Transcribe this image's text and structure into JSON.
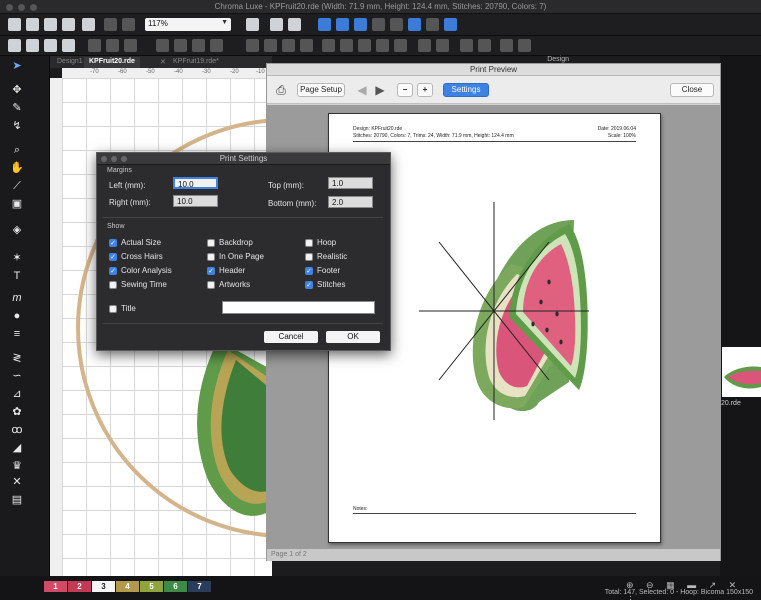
{
  "app": {
    "title": "Chroma Luxe - KPFruit20.rde (Width: 71.9 mm, Height: 124.4 mm, Stitches: 20790, Colors: 7)",
    "design_label": "Design"
  },
  "toolbar": {
    "zoom_value": "117%"
  },
  "doc_tabs": [
    "Design1",
    "KPFruit20.rde",
    "KPFruit19.rde*"
  ],
  "ruler_ticks": [
    "-70",
    "-60",
    "-50",
    "-40",
    "-30",
    "-20",
    "-10"
  ],
  "preview": {
    "window_title": "Print Preview",
    "page_setup_label": "Page Setup",
    "settings_label": "Settings",
    "close_label": "Close",
    "page_indicator": "Page 1 of 2",
    "page": {
      "design_line": "Design: KPFruit20.rde",
      "stats_line": "Stitches: 20790,   Colors: 7,  Trims: 24,   Width: 71.9 mm, Height: 124.4 mm",
      "date_line": "Date: 2019.06.04",
      "scale_line": "Scale: 100%",
      "notes_label": "Notes:"
    }
  },
  "settings": {
    "window_title": "Print Settings",
    "margins_label": "Margins",
    "left_label": "Left (mm):",
    "left_value": "10.0",
    "right_label": "Right (mm):",
    "right_value": "10.0",
    "top_label": "Top (mm):",
    "top_value": "1.0",
    "bottom_label": "Bottom (mm):",
    "bottom_value": "2.0",
    "show_label": "Show",
    "options": {
      "actual_size": {
        "label": "Actual Size",
        "checked": true
      },
      "backdrop": {
        "label": "Backdrop",
        "checked": false
      },
      "hoop": {
        "label": "Hoop",
        "checked": false
      },
      "cross_hairs": {
        "label": "Cross Hairs",
        "checked": true
      },
      "in_one_page": {
        "label": "In One Page",
        "checked": false
      },
      "realistic": {
        "label": "Realistic",
        "checked": false
      },
      "color_analysis": {
        "label": "Color Analysis",
        "checked": true
      },
      "header": {
        "label": "Header",
        "checked": true
      },
      "footer": {
        "label": "Footer",
        "checked": true
      },
      "sewing_time": {
        "label": "Sewing Time",
        "checked": false
      },
      "artworks": {
        "label": "Artworks",
        "checked": false
      },
      "stitches": {
        "label": "Stitches",
        "checked": true
      },
      "title": {
        "label": "Title",
        "checked": false
      }
    },
    "title_value": "",
    "cancel_label": "Cancel",
    "ok_label": "OK"
  },
  "right_panel": {
    "thumb_filename": "20.rde"
  },
  "status": {
    "color_chips": [
      {
        "label": "1",
        "color": "#d14a66"
      },
      {
        "label": "2",
        "color": "#c33a55"
      },
      {
        "label": "3",
        "color": "#f5f5f5"
      },
      {
        "label": "4",
        "color": "#b39a4a"
      },
      {
        "label": "5",
        "color": "#8fa33f"
      },
      {
        "label": "6",
        "color": "#3e8a47"
      },
      {
        "label": "7",
        "color": "#2a3d5a"
      }
    ],
    "text": "Total: 147, Selected: 0 - Hoop: Bicoma 150x150"
  },
  "colors": {
    "accent": "#3e82e4",
    "watermelon_flesh": "#d9557a",
    "rind_green": "#5f9b49"
  }
}
